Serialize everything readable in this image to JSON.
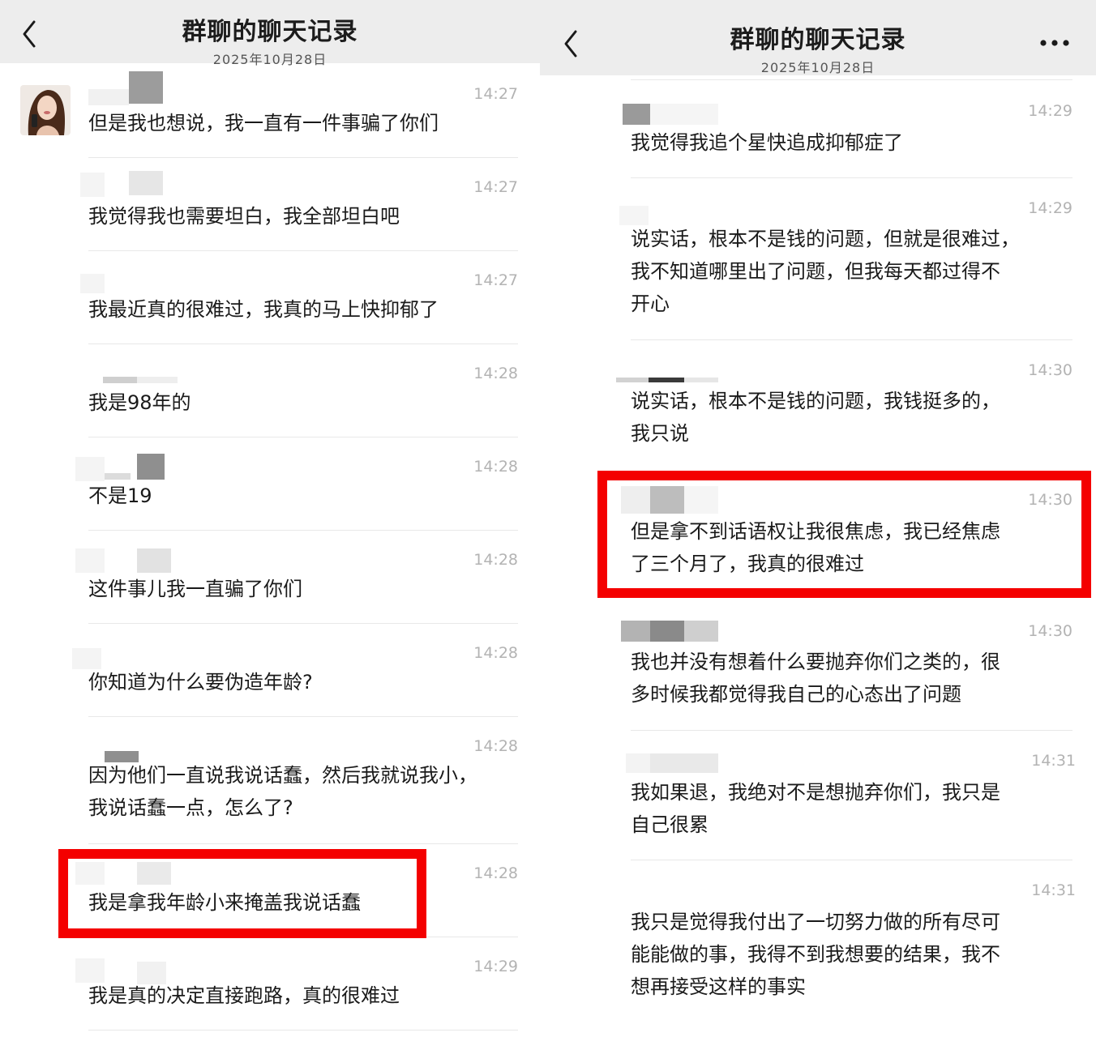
{
  "left": {
    "title": "群聊的聊天记录",
    "date": "2025年10月28日",
    "messages": [
      {
        "time": "14:27",
        "lines": [
          "但是我也想说，我一直有一件事骗了你们"
        ]
      },
      {
        "time": "14:27",
        "lines": [
          "我觉得我也需要坦白，我全部坦白吧"
        ]
      },
      {
        "time": "14:27",
        "lines": [
          "我最近真的很难过，我真的马上快抑郁了"
        ]
      },
      {
        "time": "14:28",
        "lines": [
          "我是98年的"
        ]
      },
      {
        "time": "14:28",
        "lines": [
          "不是19"
        ]
      },
      {
        "time": "14:28",
        "lines": [
          "这件事儿我一直骗了你们"
        ]
      },
      {
        "time": "14:28",
        "lines": [
          "你知道为什么要伪造年龄?"
        ]
      },
      {
        "time": "14:28",
        "lines": [
          "因为他们一直说我说话蠢，然后我就说我小，",
          "我说话蠢一点，怎么了?"
        ]
      },
      {
        "time": "14:28",
        "lines": [
          "我是拿我年龄小来掩盖我说话蠢"
        ]
      },
      {
        "time": "14:29",
        "lines": [
          "我是真的决定直接跑路，真的很难过"
        ]
      }
    ]
  },
  "right": {
    "title": "群聊的聊天记录",
    "date": "2025年10月28日",
    "more_icon": "more-icon",
    "messages": [
      {
        "time": "14:29",
        "lines": [
          "我觉得我追个星快追成抑郁症了"
        ]
      },
      {
        "time": "14:29",
        "lines": [
          "说实话，根本不是钱的问题，但就是很难过，",
          "我不知道哪里出了问题，但我每天都过得不",
          "开心"
        ]
      },
      {
        "time": "14:30",
        "lines": [
          "说实话，根本不是钱的问题，我钱挺多的，",
          "我只说"
        ]
      },
      {
        "time": "14:30",
        "lines": [
          "但是拿不到话语权让我很焦虑，我已经焦虑",
          "了三个月了，我真的很难过"
        ]
      },
      {
        "time": "14:30",
        "lines": [
          "我也并没有想着什么要抛弃你们之类的，很",
          "多时候我都觉得我自己的心态出了问题"
        ]
      },
      {
        "time": "14:31",
        "lines": [
          "我如果退，我绝对不是想抛弃你们，我只是",
          "自己很累"
        ]
      },
      {
        "time": "14:31",
        "lines": [
          "我只是觉得我付出了一切努力做的所有尽可",
          "能能做的事，我得不到我想要的结果，我不",
          "想再接受这样的事实"
        ]
      }
    ]
  },
  "colors": {
    "highlight": "#f40000",
    "header_bg": "#ededed",
    "time": "#b3b3b3"
  }
}
